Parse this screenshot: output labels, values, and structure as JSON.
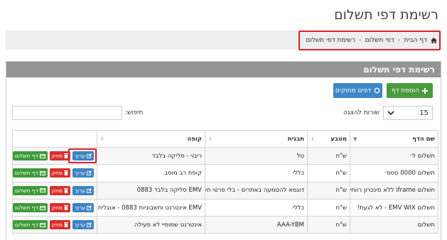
{
  "page": {
    "title": "רשימת דפי תשלום"
  },
  "breadcrumb": [
    {
      "label": "דף הבית"
    },
    {
      "label": "דפי תשלום"
    },
    {
      "label": "רשימת דפי תשלום"
    }
  ],
  "panel": {
    "title": "רשימת דפי תשלום"
  },
  "toolbar": {
    "add_label": "הוספת דף",
    "print_label": "דפים מחוקים"
  },
  "table_controls": {
    "rows_value": "15",
    "rows_label": "שורות להצגה",
    "search_label": "חיפוש:",
    "search_value": ""
  },
  "table": {
    "columns": [
      "שם הדף",
      "מטבע",
      "תבנית",
      "קופה",
      ""
    ],
    "action_labels": {
      "edit": "ערוך",
      "delete": "מחק",
      "page": "דף תשלום"
    },
    "rows": [
      {
        "name": "תשלום ל׳",
        "currency": "ש\"ח",
        "template": "טל",
        "register": "ריבוי - סליקה בלבד"
      },
      {
        "name": "תשלום 0000 ססס׳",
        "currency": "ש\"ח",
        "template": "כללי",
        "register": "קופת רב מוסב"
      },
      {
        "name": "תשלום iframe ללא סינכרון רווחית",
        "currency": "ש\"ח",
        "template": "דוגמא להטמעה באתרים - בלי פרטי חשבונית",
        "register": "EMV סליקה בלבד 0883"
      },
      {
        "name": "תשלום EMV WIX - לא לגעת!",
        "currency": "ש\"ח",
        "template": "כללי",
        "register": "EMV אינטרנט וחשבוניות 0883 - אנגלית"
      },
      {
        "name": "תשלום",
        "currency": "ש\"ח",
        "template": "AAA-YBM",
        "register": "אינטרנט שמופיי לא פעילה"
      }
    ]
  },
  "colors": {
    "add": "#4a9b3e",
    "print": "#3f86c7",
    "edit": "#3d83c5",
    "delete": "#d9302d",
    "page": "#3e9b3a",
    "highlight": "#d9232d"
  }
}
